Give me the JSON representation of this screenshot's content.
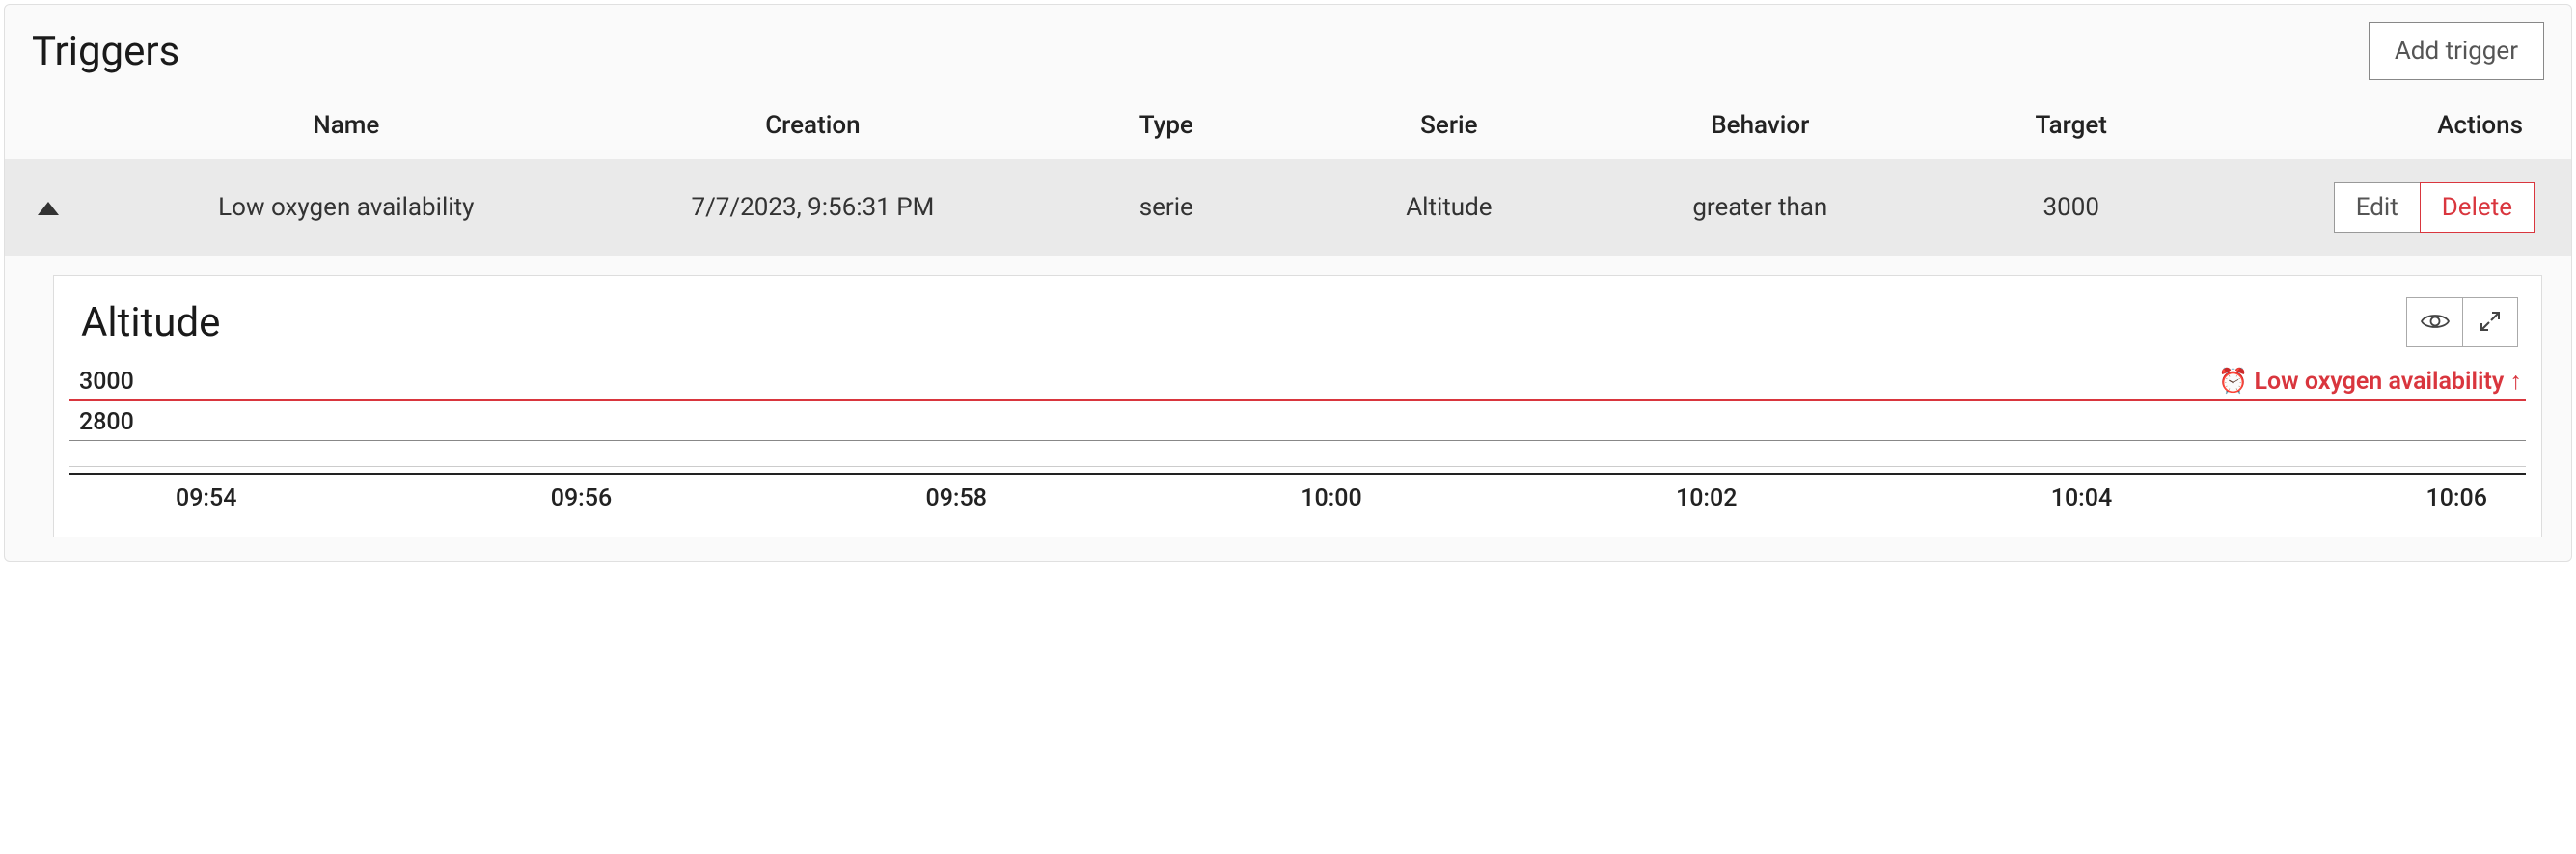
{
  "title": "Triggers",
  "add_trigger_label": "Add trigger",
  "columns": {
    "name": "Name",
    "creation": "Creation",
    "type": "Type",
    "serie": "Serie",
    "behavior": "Behavior",
    "target": "Target",
    "actions": "Actions"
  },
  "rows": [
    {
      "name": "Low oxygen availability",
      "creation": "7/7/2023, 9:56:31 PM",
      "type": "serie",
      "serie": "Altitude",
      "behavior": "greater than",
      "target": "3000",
      "edit_label": "Edit",
      "delete_label": "Delete"
    }
  ],
  "chart": {
    "title": "Altitude",
    "threshold_value": "3000",
    "threshold_label": "⏰ Low oxygen availability ↑",
    "y_tick": "2800",
    "x_ticks": [
      "09:54",
      "09:56",
      "09:58",
      "10:00",
      "10:02",
      "10:04",
      "10:06"
    ]
  },
  "chart_data": {
    "type": "line",
    "title": "Altitude",
    "xlabel": "",
    "ylabel": "",
    "ylim": [
      2800,
      3000
    ],
    "threshold": {
      "value": 3000,
      "label": "Low oxygen availability",
      "direction": "up"
    },
    "x_ticks": [
      "09:54",
      "09:56",
      "09:58",
      "10:00",
      "10:02",
      "10:04",
      "10:06"
    ],
    "series": []
  }
}
